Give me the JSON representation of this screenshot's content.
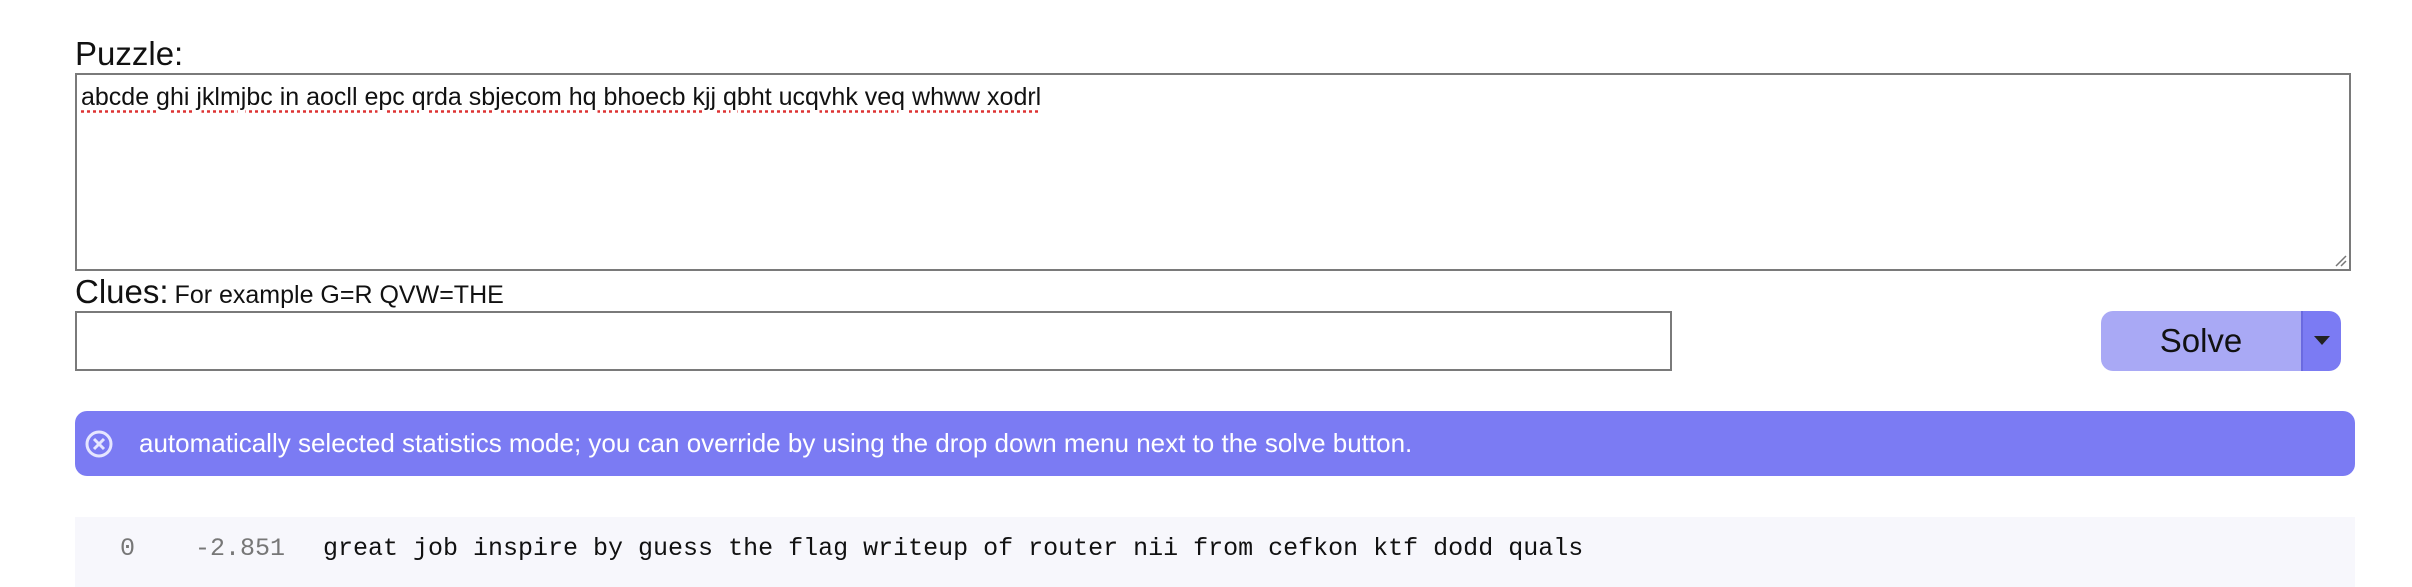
{
  "puzzle": {
    "label": "Puzzle:",
    "value": "abcde ghi jklmjbc in aocll epc qrda sbjecom hq bhoecb kjj qbht ucqvhk veq whww xodrl"
  },
  "clues": {
    "label": "Clues:",
    "hint": "For example G=R QVW=THE",
    "value": ""
  },
  "solve": {
    "label": "Solve",
    "dropdown_icon": "caret-down-icon"
  },
  "alert": {
    "icon": "circle-x-icon",
    "message": "automatically selected statistics mode; you can override by using the drop down menu next to the solve button."
  },
  "results": [
    {
      "index": "0",
      "score": "-2.851",
      "text": "great job inspire by guess the flag writeup of router nii from cefkon ktf dodd quals"
    }
  ],
  "colors": {
    "accent": "#7b7bf3",
    "accent_light": "#a9a9f5",
    "result_bg": "#f7f7fc"
  }
}
